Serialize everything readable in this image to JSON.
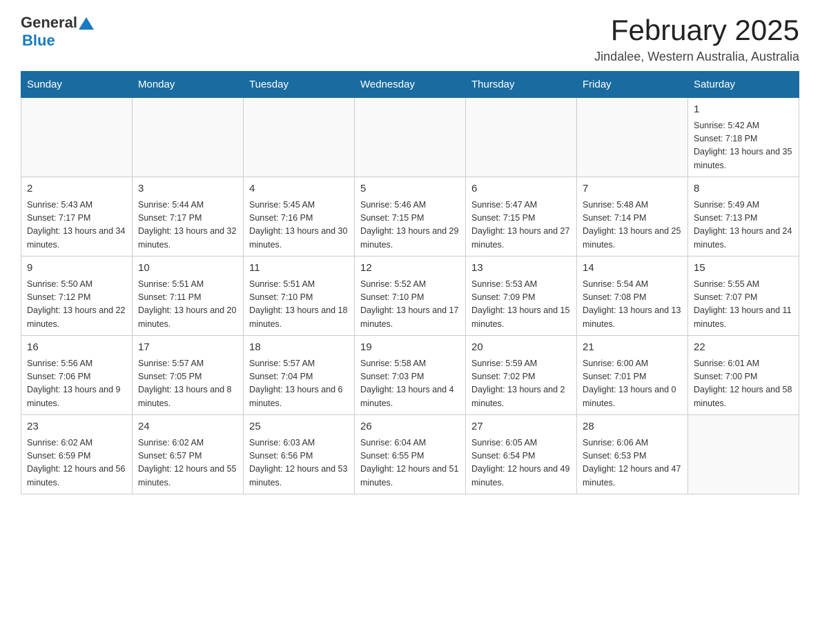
{
  "header": {
    "logo_general": "General",
    "logo_blue": "Blue",
    "title": "February 2025",
    "location": "Jindalee, Western Australia, Australia"
  },
  "days_of_week": [
    "Sunday",
    "Monday",
    "Tuesday",
    "Wednesday",
    "Thursday",
    "Friday",
    "Saturday"
  ],
  "weeks": [
    [
      {
        "day": "",
        "info": ""
      },
      {
        "day": "",
        "info": ""
      },
      {
        "day": "",
        "info": ""
      },
      {
        "day": "",
        "info": ""
      },
      {
        "day": "",
        "info": ""
      },
      {
        "day": "",
        "info": ""
      },
      {
        "day": "1",
        "info": "Sunrise: 5:42 AM\nSunset: 7:18 PM\nDaylight: 13 hours and 35 minutes."
      }
    ],
    [
      {
        "day": "2",
        "info": "Sunrise: 5:43 AM\nSunset: 7:17 PM\nDaylight: 13 hours and 34 minutes."
      },
      {
        "day": "3",
        "info": "Sunrise: 5:44 AM\nSunset: 7:17 PM\nDaylight: 13 hours and 32 minutes."
      },
      {
        "day": "4",
        "info": "Sunrise: 5:45 AM\nSunset: 7:16 PM\nDaylight: 13 hours and 30 minutes."
      },
      {
        "day": "5",
        "info": "Sunrise: 5:46 AM\nSunset: 7:15 PM\nDaylight: 13 hours and 29 minutes."
      },
      {
        "day": "6",
        "info": "Sunrise: 5:47 AM\nSunset: 7:15 PM\nDaylight: 13 hours and 27 minutes."
      },
      {
        "day": "7",
        "info": "Sunrise: 5:48 AM\nSunset: 7:14 PM\nDaylight: 13 hours and 25 minutes."
      },
      {
        "day": "8",
        "info": "Sunrise: 5:49 AM\nSunset: 7:13 PM\nDaylight: 13 hours and 24 minutes."
      }
    ],
    [
      {
        "day": "9",
        "info": "Sunrise: 5:50 AM\nSunset: 7:12 PM\nDaylight: 13 hours and 22 minutes."
      },
      {
        "day": "10",
        "info": "Sunrise: 5:51 AM\nSunset: 7:11 PM\nDaylight: 13 hours and 20 minutes."
      },
      {
        "day": "11",
        "info": "Sunrise: 5:51 AM\nSunset: 7:10 PM\nDaylight: 13 hours and 18 minutes."
      },
      {
        "day": "12",
        "info": "Sunrise: 5:52 AM\nSunset: 7:10 PM\nDaylight: 13 hours and 17 minutes."
      },
      {
        "day": "13",
        "info": "Sunrise: 5:53 AM\nSunset: 7:09 PM\nDaylight: 13 hours and 15 minutes."
      },
      {
        "day": "14",
        "info": "Sunrise: 5:54 AM\nSunset: 7:08 PM\nDaylight: 13 hours and 13 minutes."
      },
      {
        "day": "15",
        "info": "Sunrise: 5:55 AM\nSunset: 7:07 PM\nDaylight: 13 hours and 11 minutes."
      }
    ],
    [
      {
        "day": "16",
        "info": "Sunrise: 5:56 AM\nSunset: 7:06 PM\nDaylight: 13 hours and 9 minutes."
      },
      {
        "day": "17",
        "info": "Sunrise: 5:57 AM\nSunset: 7:05 PM\nDaylight: 13 hours and 8 minutes."
      },
      {
        "day": "18",
        "info": "Sunrise: 5:57 AM\nSunset: 7:04 PM\nDaylight: 13 hours and 6 minutes."
      },
      {
        "day": "19",
        "info": "Sunrise: 5:58 AM\nSunset: 7:03 PM\nDaylight: 13 hours and 4 minutes."
      },
      {
        "day": "20",
        "info": "Sunrise: 5:59 AM\nSunset: 7:02 PM\nDaylight: 13 hours and 2 minutes."
      },
      {
        "day": "21",
        "info": "Sunrise: 6:00 AM\nSunset: 7:01 PM\nDaylight: 13 hours and 0 minutes."
      },
      {
        "day": "22",
        "info": "Sunrise: 6:01 AM\nSunset: 7:00 PM\nDaylight: 12 hours and 58 minutes."
      }
    ],
    [
      {
        "day": "23",
        "info": "Sunrise: 6:02 AM\nSunset: 6:59 PM\nDaylight: 12 hours and 56 minutes."
      },
      {
        "day": "24",
        "info": "Sunrise: 6:02 AM\nSunset: 6:57 PM\nDaylight: 12 hours and 55 minutes."
      },
      {
        "day": "25",
        "info": "Sunrise: 6:03 AM\nSunset: 6:56 PM\nDaylight: 12 hours and 53 minutes."
      },
      {
        "day": "26",
        "info": "Sunrise: 6:04 AM\nSunset: 6:55 PM\nDaylight: 12 hours and 51 minutes."
      },
      {
        "day": "27",
        "info": "Sunrise: 6:05 AM\nSunset: 6:54 PM\nDaylight: 12 hours and 49 minutes."
      },
      {
        "day": "28",
        "info": "Sunrise: 6:06 AM\nSunset: 6:53 PM\nDaylight: 12 hours and 47 minutes."
      },
      {
        "day": "",
        "info": ""
      }
    ]
  ]
}
